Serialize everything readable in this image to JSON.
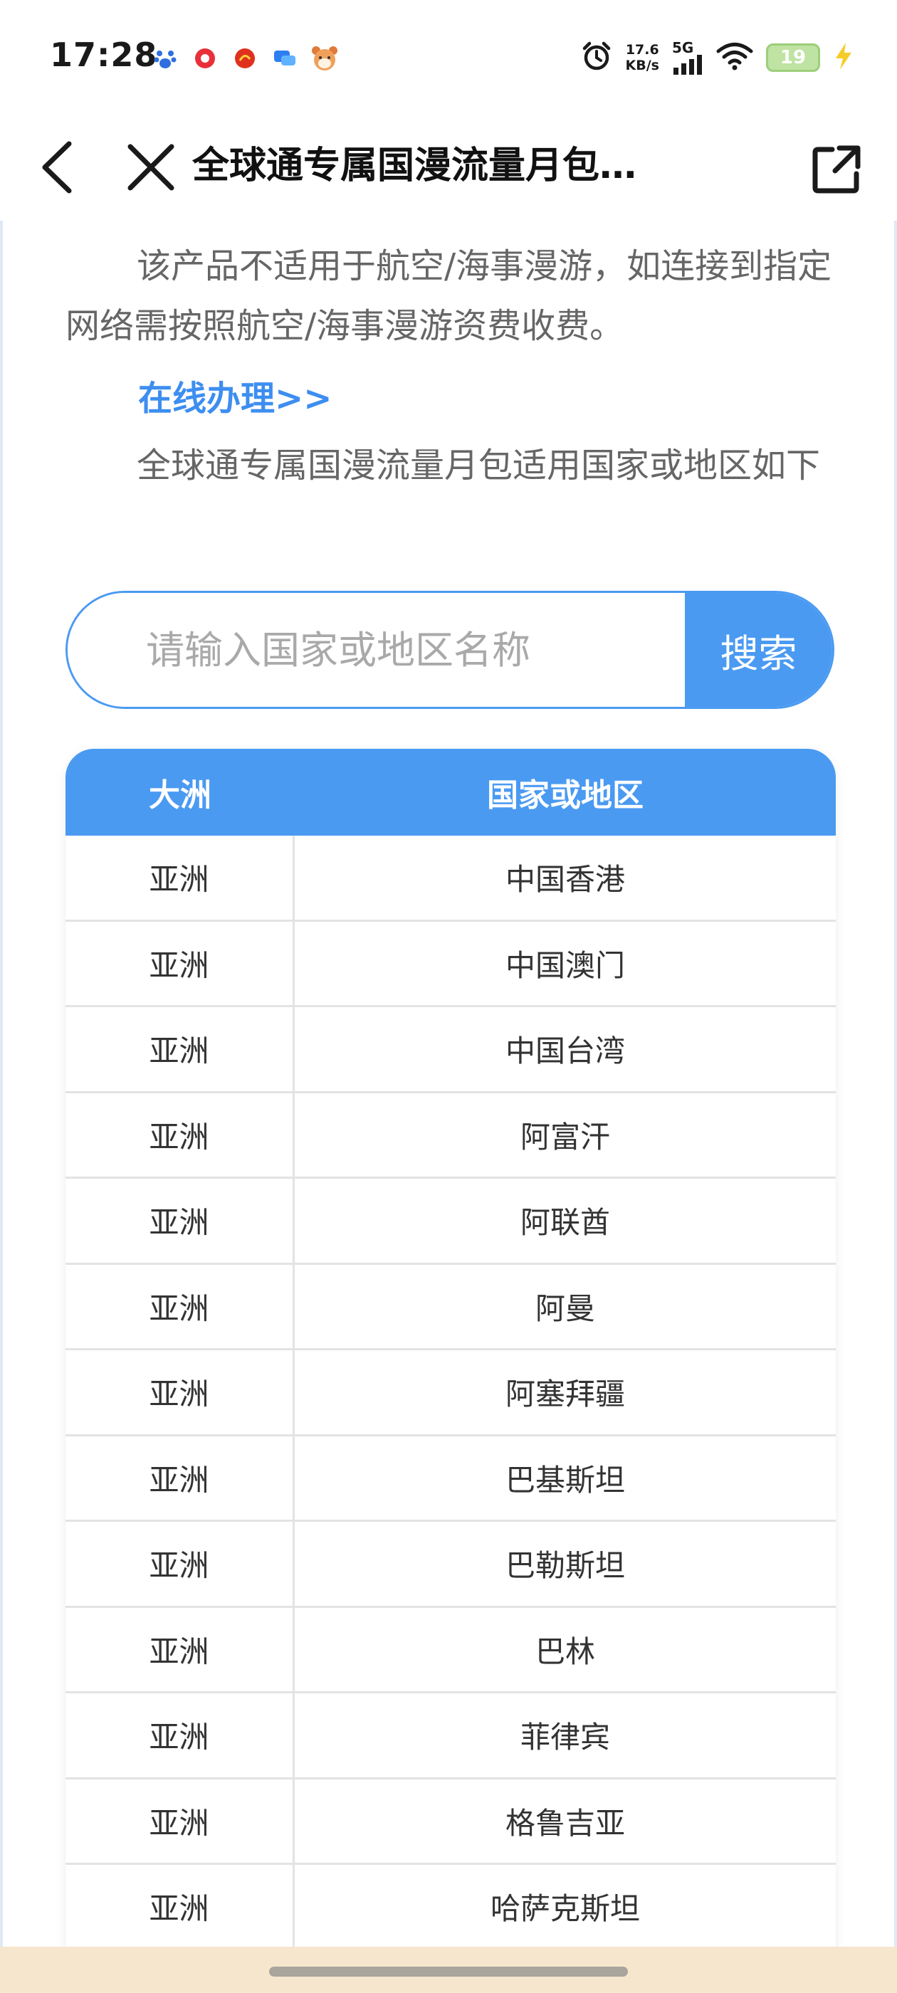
{
  "status_bar": {
    "time": "17:28",
    "net_speed_value": "17.6",
    "net_speed_unit": "KB/s",
    "signal_label": "5G",
    "battery_level": "19",
    "notification_icons": [
      "baidu-paw-icon",
      "red-play-icon",
      "red-circle-app-icon",
      "blue-chat-icon",
      "bear-app-icon"
    ]
  },
  "nav": {
    "title": "全球通专属国漫流量月包…"
  },
  "content": {
    "paragraph_1": "该产品不适用于航空/海事漫游，如连接到指定网络需按照航空/海事漫游资费收费。",
    "online_link": "在线办理>>",
    "paragraph_2": "全球通专属国漫流量月包适用国家或地区如下"
  },
  "search": {
    "placeholder": "请输入国家或地区名称",
    "button_label": "搜索"
  },
  "table": {
    "headers": [
      "大洲",
      "国家或地区"
    ],
    "rows": [
      [
        "亚洲",
        "中国香港"
      ],
      [
        "亚洲",
        "中国澳门"
      ],
      [
        "亚洲",
        "中国台湾"
      ],
      [
        "亚洲",
        "阿富汗"
      ],
      [
        "亚洲",
        "阿联酋"
      ],
      [
        "亚洲",
        "阿曼"
      ],
      [
        "亚洲",
        "阿塞拜疆"
      ],
      [
        "亚洲",
        "巴基斯坦"
      ],
      [
        "亚洲",
        "巴勒斯坦"
      ],
      [
        "亚洲",
        "巴林"
      ],
      [
        "亚洲",
        "菲律宾"
      ],
      [
        "亚洲",
        "格鲁吉亚"
      ],
      [
        "亚洲",
        "哈萨克斯坦"
      ]
    ]
  },
  "colors": {
    "accent": "#4a9af2",
    "link": "#3d8ef0",
    "body_text": "#666666",
    "bottom_bar": "#f6e6cd"
  }
}
